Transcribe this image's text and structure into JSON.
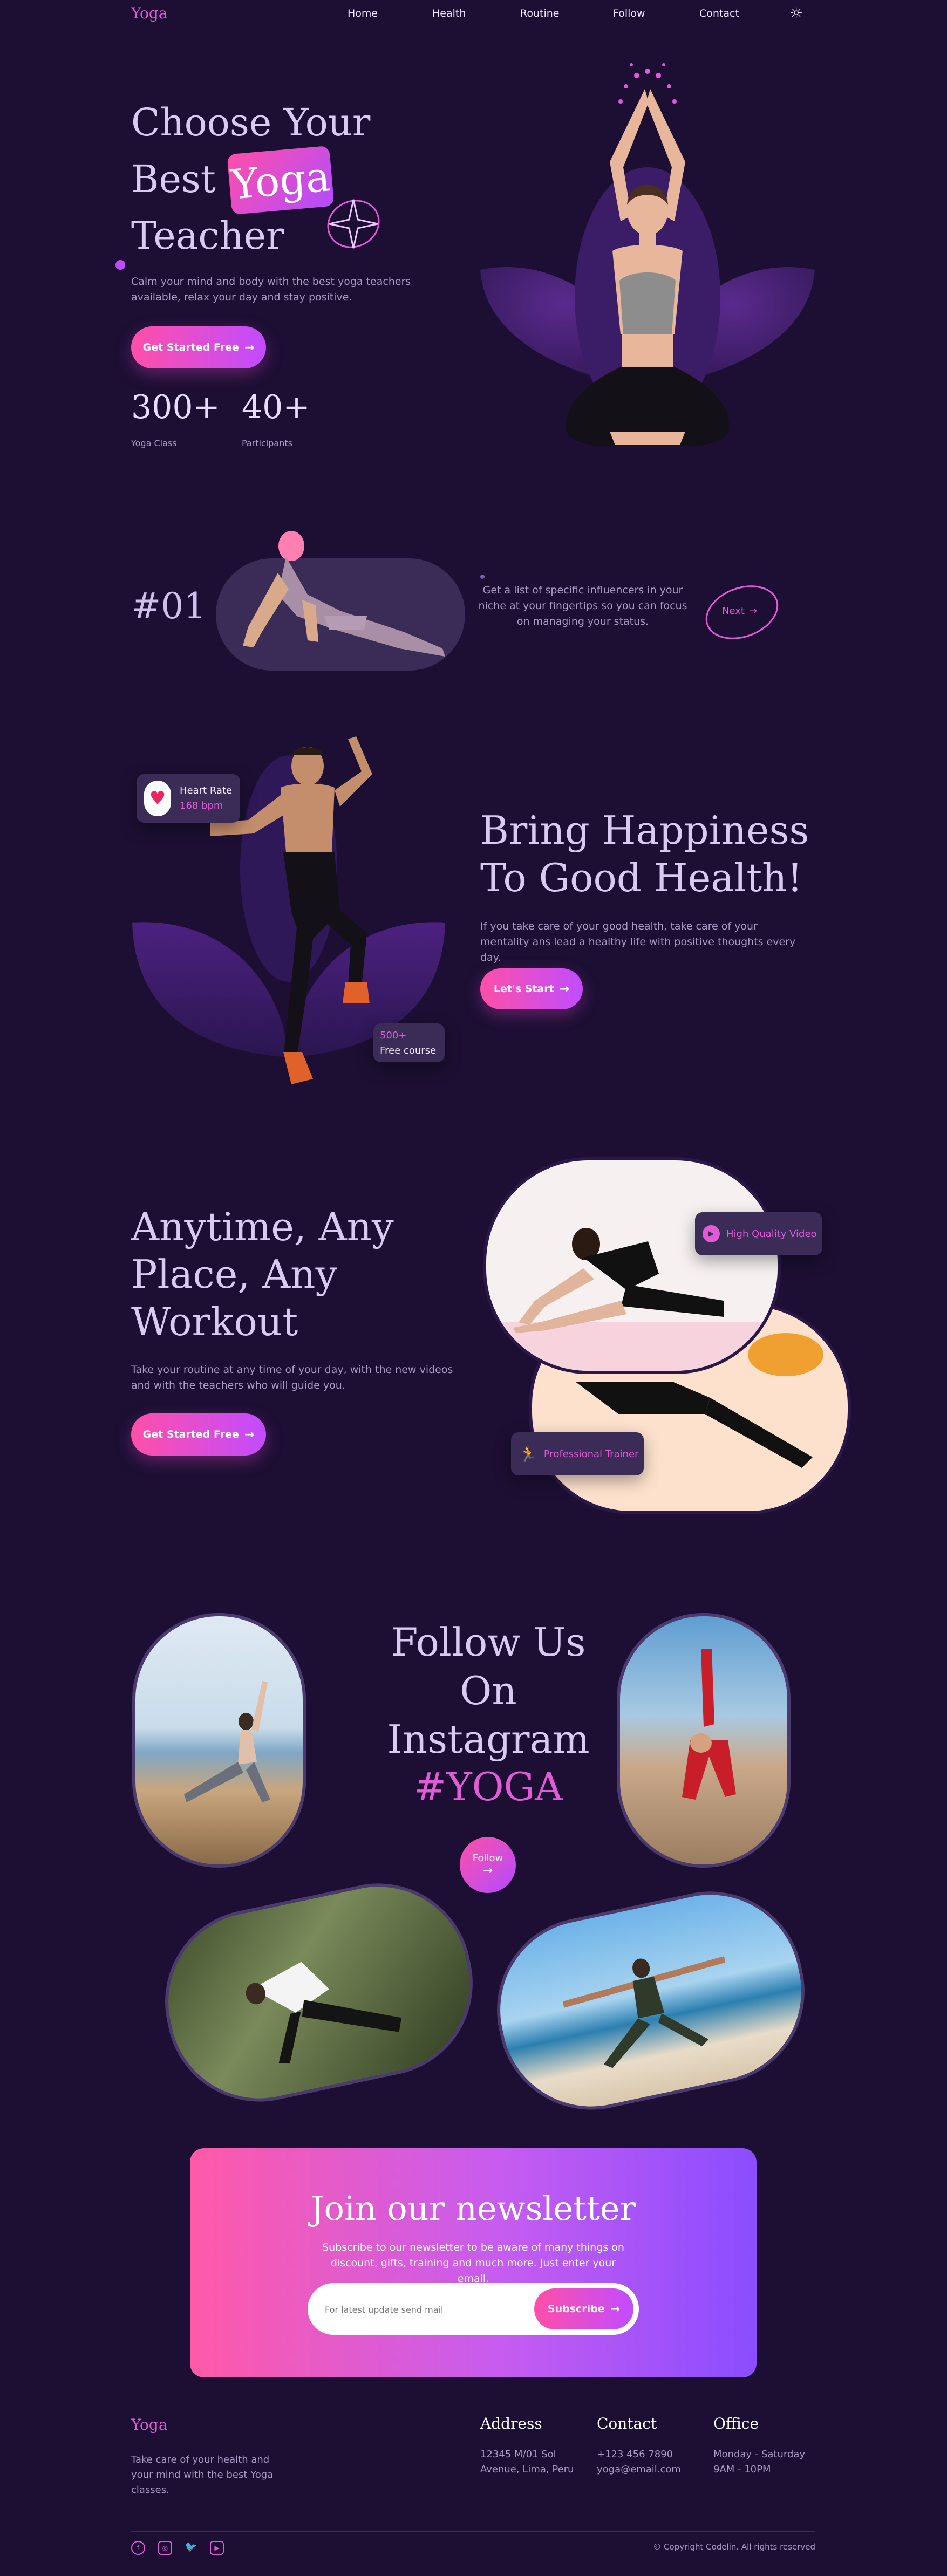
{
  "nav": {
    "logo": "Yoga",
    "links": [
      "Home",
      "Health",
      "Routine",
      "Follow",
      "Contact"
    ]
  },
  "hero": {
    "title_line1": "Choose Your",
    "title_best": "Best",
    "title_yoga": "Yoga",
    "title_line3": "Teacher",
    "description": "Calm your mind and body with the best yoga teachers available, relax your day and stay positive.",
    "cta": "Get Started Free",
    "stats": [
      {
        "value": "300+",
        "label": "Yoga Class"
      },
      {
        "value": "40+",
        "label": "Participants"
      }
    ]
  },
  "influencer": {
    "number": "#01",
    "text": "Get a list of specific influencers in your niche at your fingertips so you can focus on managing your status.",
    "next": "Next"
  },
  "health": {
    "title_line1": "Bring Happiness",
    "title_line2": "To Good Health!",
    "description": "If you take care of your good health, take care of your mentality ans lead a healthy life with positive thoughts every day.",
    "cta": "Let's Start",
    "heart_label": "Heart Rate",
    "heart_value": "168 bpm",
    "course_count": "500+",
    "course_label": "Free course"
  },
  "anytime": {
    "title_line1": "Anytime, Any",
    "title_line2": "Place, Any",
    "title_line3": "Workout",
    "description": "Take your routine at any time of your day, with the new videos and with the teachers who will guide you.",
    "cta": "Get Started Free",
    "video_badge": "High Quality Video",
    "trainer_badge": "Professional Trainer"
  },
  "instagram": {
    "title_line1": "Follow Us",
    "title_line2": "On",
    "title_line3": "Instagram",
    "hashtag": "#YOGA",
    "follow": "Follow"
  },
  "newsletter": {
    "title": "Join our newsletter",
    "description": "Subscribe to our newsletter to be aware of many things on discount, gifts, training and much more. Just enter your email.",
    "placeholder": "For latest update send mail",
    "button": "Subscribe"
  },
  "footer": {
    "logo": "Yoga",
    "tagline": "Take care of your health and your mind with the best Yoga classes.",
    "address_title": "Address",
    "address_line1": "12345 M/01 Sol",
    "address_line2": "Avenue, Lima, Peru",
    "contact_title": "Contact",
    "phone": "+123 456 7890",
    "email": "yoga@email.com",
    "office_title": "Office",
    "office_days": "Monday - Saturday",
    "office_hours": "9AM - 10PM",
    "copyright": "© Copyright Codelin. All rights reserved"
  },
  "colors": {
    "background": "#1c0f33",
    "accent_pink": "#e25bd6",
    "gradient_start": "#ff4fa8",
    "gradient_end": "#9a4dff"
  }
}
